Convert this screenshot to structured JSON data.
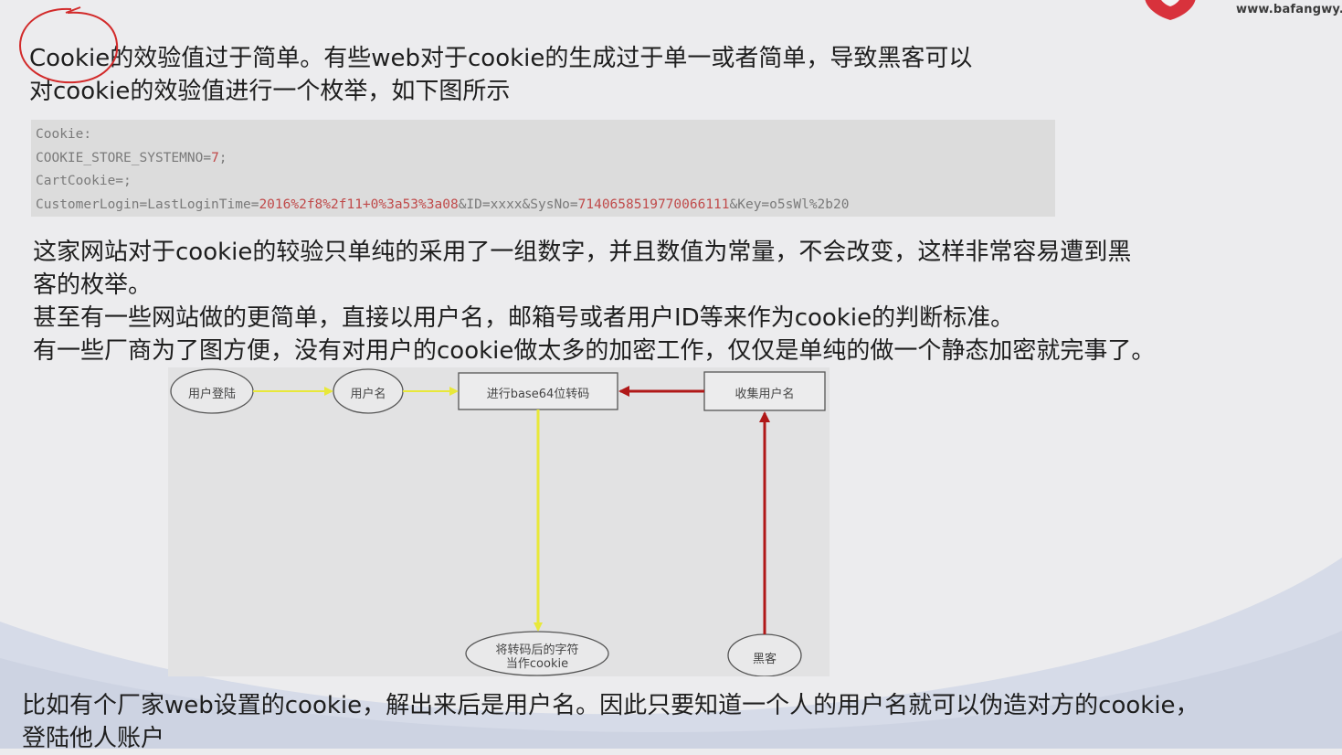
{
  "header": {
    "site_url": "www.bafangwy.com"
  },
  "intro": {
    "line1": "Cookie的效验值过于简单。有些web对于cookie的生成过于单一或者简单，导致黑客可以",
    "line2": "对cookie的效验值进行一个枚举，如下图所示"
  },
  "code_block": {
    "line1": "Cookie:",
    "line2_key": "COOKIE_STORE_SYSTEMNO=",
    "line2_val": "7",
    "line2_end": ";",
    "line3": "CartCookie=;",
    "line4_a": "CustomerLogin=LastLoginTime=",
    "line4_b": "2016%2f8%2f11+0%3a53%3a08",
    "line4_c": "&ID=xxxx&SysNo=",
    "line4_d": "7140658519770066111",
    "line4_e": "&Key=o5sWl%2b20"
  },
  "body": {
    "line1": "这家网站对于cookie的较验只单纯的采用了一组数字，并且数值为常量，不会改变，这样非常容易遭到黑",
    "line2": "客的枚举。",
    "line3": "甚至有一些网站做的更简单，直接以用户名，邮箱号或者用户ID等来作为cookie的判断标准。",
    "line4": "有一些厂商为了图方便，没有对用户的cookie做太多的加密工作，仅仅是单纯的做一个静态加密就完事了。"
  },
  "diagram": {
    "node_login": "用户登陆",
    "node_username": "用户名",
    "node_base64": "进行base64位转码",
    "node_collect": "收集用户名",
    "node_result_line1": "将转码后的字符",
    "node_result_line2": "当作cookie",
    "node_hacker": "黑客",
    "colors": {
      "yellow_arrow": "#e8e83a",
      "red_arrow": "#b01818"
    }
  },
  "footer": {
    "line1": "比如有个厂家web设置的cookie，解出来后是用户名。因此只要知道一个人的用户名就可以伪造对方的cookie，",
    "line2": "登陆他人账户"
  }
}
